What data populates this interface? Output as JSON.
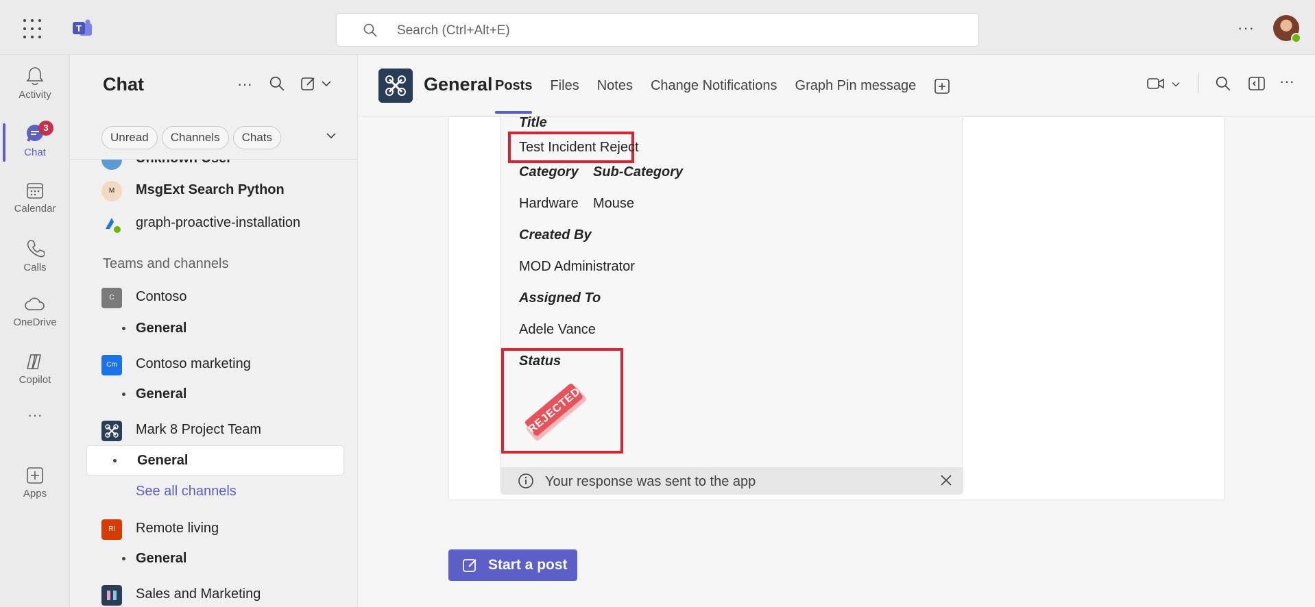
{
  "search": {
    "placeholder": "Search (Ctrl+Alt+E)"
  },
  "rail": {
    "items": [
      {
        "label": "Activity",
        "icon": "bell-icon"
      },
      {
        "label": "Chat",
        "icon": "chat-icon",
        "badge": "3"
      },
      {
        "label": "Calendar",
        "icon": "calendar-icon"
      },
      {
        "label": "Calls",
        "icon": "phone-icon"
      },
      {
        "label": "OneDrive",
        "icon": "cloud-icon"
      },
      {
        "label": "Copilot",
        "icon": "copilot-icon"
      },
      {
        "label": "Apps",
        "icon": "plus-square-icon"
      }
    ]
  },
  "chatlist": {
    "title": "Chat",
    "filters": [
      "Unread",
      "Channels",
      "Chats"
    ],
    "chats": [
      {
        "label": "Unknown User"
      },
      {
        "label": "MsgExt Search Python"
      },
      {
        "label": "graph-proactive-installation"
      }
    ],
    "section_label": "Teams and channels",
    "teams": [
      {
        "name": "Contoso",
        "initials": "C",
        "color": "#7a7a7a",
        "channel": "General"
      },
      {
        "name": "Contoso marketing",
        "initials": "Cm",
        "color": "#1a73e8",
        "channel": "General"
      },
      {
        "name": "Mark 8 Project Team",
        "initials": "",
        "color": "#2a3d56",
        "channel": "General"
      },
      {
        "name": "Remote living",
        "initials": "Rl",
        "color": "#d83b01",
        "channel": "General"
      },
      {
        "name": "Sales and Marketing",
        "initials": "",
        "color": "#2a3d56"
      }
    ],
    "see_all": "See all channels"
  },
  "channel": {
    "title": "General",
    "tabs": [
      "Posts",
      "Files",
      "Notes",
      "Change Notifications",
      "Graph Pin message"
    ]
  },
  "card": {
    "title_label": "Title",
    "title_value": "Test Incident Reject",
    "category_label": "Category",
    "subcategory_label": "Sub-Category",
    "category_value": "Hardware",
    "subcategory_value": "Mouse",
    "created_by_label": "Created By",
    "created_by_value": "MOD Administrator",
    "assigned_to_label": "Assigned To",
    "assigned_to_value": "Adele Vance",
    "status_label": "Status",
    "status_stamp": "REJECTED",
    "notice": "Your response was sent to the app"
  },
  "start_post": "Start a post",
  "colors": {
    "accent": "#5b5fc7",
    "highlight": "#d9252f",
    "stamp": "#e8525a"
  }
}
